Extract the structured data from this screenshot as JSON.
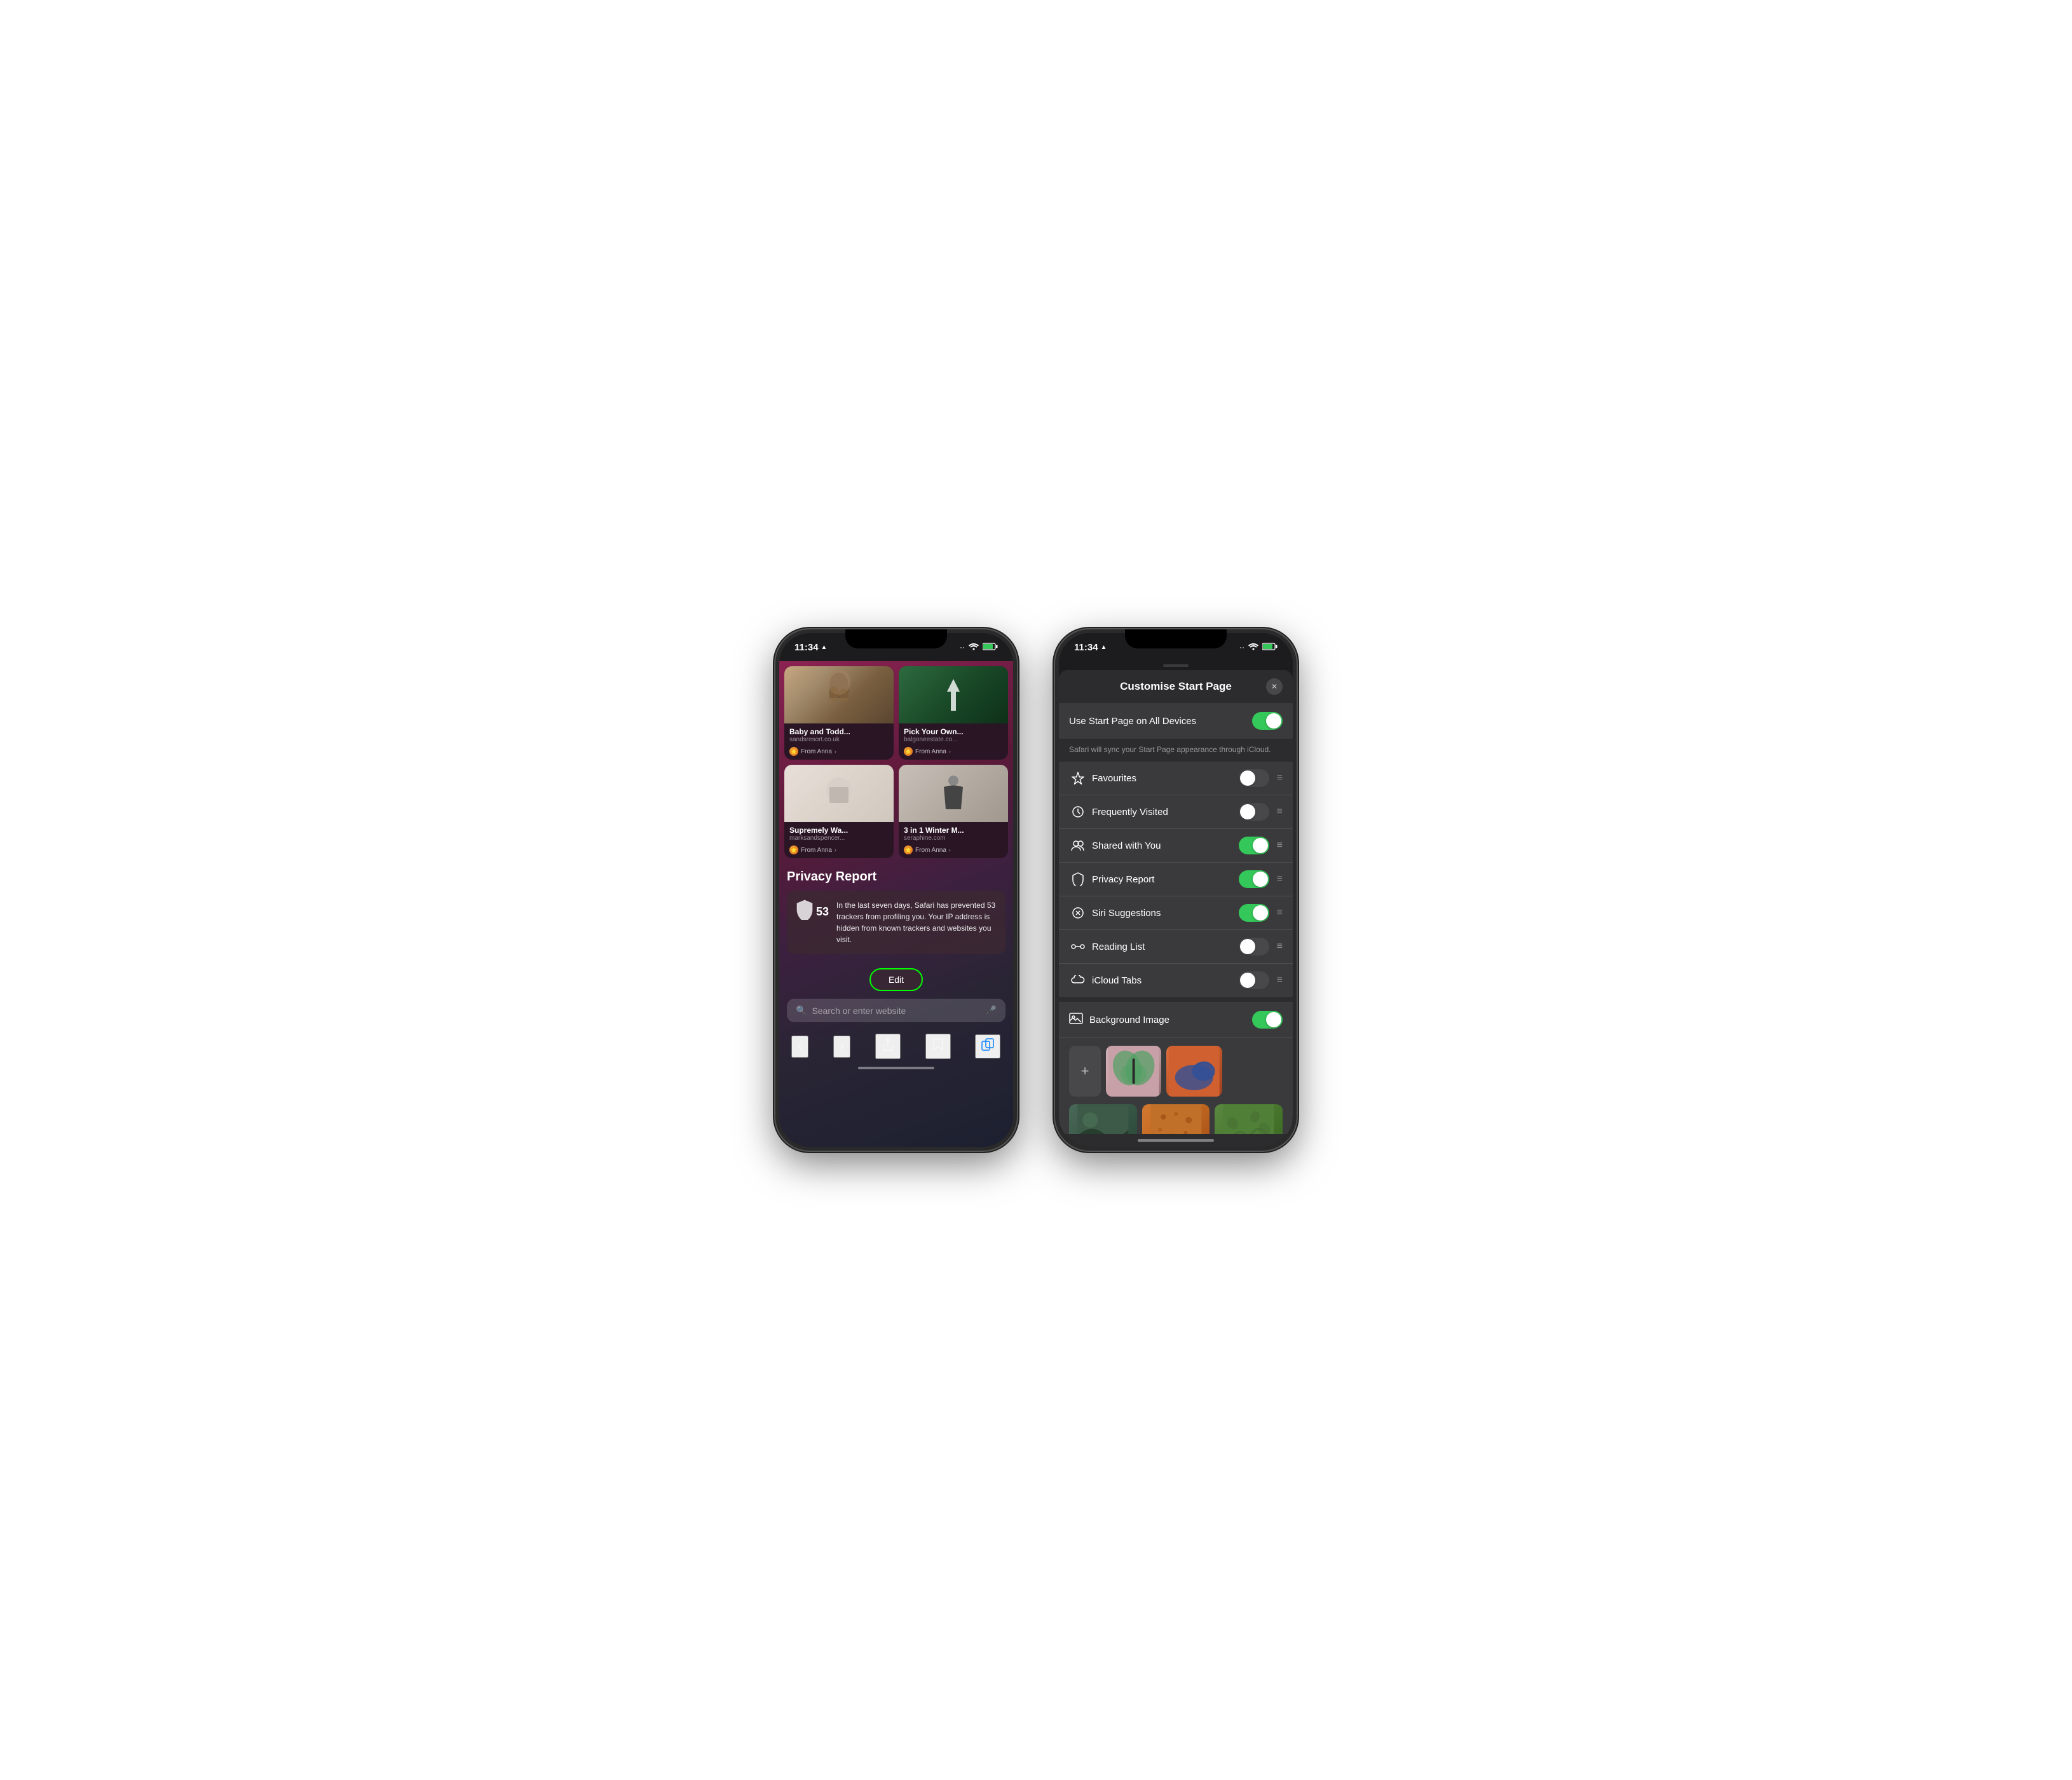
{
  "phone1": {
    "status": {
      "time": "11:34",
      "location_icon": "▲",
      "wifi": "WiFi",
      "battery": "🔋"
    },
    "cards": [
      {
        "title": "Baby and Todd...",
        "url": "sandsresort.co.uk",
        "from": "From Anna"
      },
      {
        "title": "Pick Your Own...",
        "url": "balgoneestate.co...",
        "from": "From Anna"
      },
      {
        "title": "Supremely Wa...",
        "url": "marksandspencer...",
        "from": "From Anna"
      },
      {
        "title": "3 in 1 Winter M...",
        "url": "seraphine.com",
        "from": "From Anna"
      }
    ],
    "privacy": {
      "title": "Privacy Report",
      "count": "53",
      "description": "In the last seven days, Safari has prevented 53 trackers from profiling you. Your IP address is hidden from known trackers and websites you visit."
    },
    "edit_button": "Edit",
    "search_placeholder": "Search or enter website",
    "nav": {
      "back": "‹",
      "forward": "›",
      "share": "⬆",
      "bookmarks": "📖",
      "tabs": "⬜"
    }
  },
  "phone2": {
    "status": {
      "time": "11:34",
      "location_icon": "▲"
    },
    "panel": {
      "title": "Customise Start Page",
      "close": "✕",
      "sync_label": "Use Start Page on All Devices",
      "sync_on": true,
      "sync_subtitle": "Safari will sync your Start Page appearance through iCloud.",
      "items": [
        {
          "icon": "☆",
          "label": "Favourites",
          "on": false
        },
        {
          "icon": "🕐",
          "label": "Frequently Visited",
          "on": false
        },
        {
          "icon": "👥",
          "label": "Shared with You",
          "on": true
        },
        {
          "icon": "🛡",
          "label": "Privacy Report",
          "on": true
        },
        {
          "icon": "⊗",
          "label": "Siri Suggestions",
          "on": true
        },
        {
          "icon": "◎",
          "label": "Reading List",
          "on": false
        },
        {
          "icon": "☁",
          "label": "iCloud Tabs",
          "on": false
        }
      ],
      "background_label": "Background Image",
      "background_on": true,
      "add_button": "+",
      "bg_images": [
        "butterfly",
        "rhino",
        "teal",
        "orange",
        "green"
      ]
    }
  }
}
